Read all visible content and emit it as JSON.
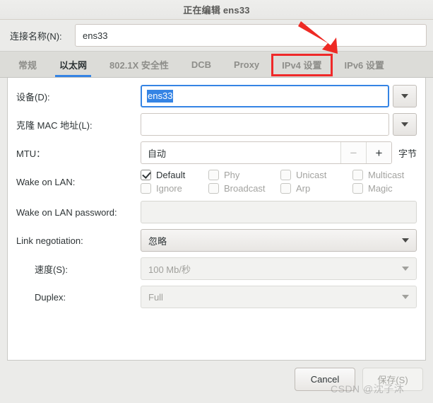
{
  "window": {
    "title": "正在编辑 ens33"
  },
  "connection": {
    "label": "连接名称(N):",
    "value": "ens33",
    "placeholder": ""
  },
  "tabs": [
    {
      "label": "常规",
      "active": false
    },
    {
      "label": "以太网",
      "active": true
    },
    {
      "label": "802.1X 安全性",
      "active": false
    },
    {
      "label": "DCB",
      "active": false
    },
    {
      "label": "Proxy",
      "active": false
    },
    {
      "label": "IPv4 设置",
      "active": false,
      "annotated": true
    },
    {
      "label": "IPv6 设置",
      "active": false
    }
  ],
  "form": {
    "device": {
      "label": "设备(D):",
      "value": "ens33",
      "selected": true
    },
    "cloned_mac": {
      "label": "克隆 MAC 地址(L):",
      "value": ""
    },
    "mtu": {
      "label": "MTU：",
      "value": "自动",
      "minus": "−",
      "plus": "+",
      "unit": "字节"
    },
    "wake_on_lan": {
      "label": "Wake on LAN:",
      "options": [
        {
          "label": "Default",
          "checked": true,
          "enabled": true
        },
        {
          "label": "Phy",
          "checked": false,
          "enabled": false
        },
        {
          "label": "Unicast",
          "checked": false,
          "enabled": false
        },
        {
          "label": "Multicast",
          "checked": false,
          "enabled": false
        },
        {
          "label": "Ignore",
          "checked": false,
          "enabled": false
        },
        {
          "label": "Broadcast",
          "checked": false,
          "enabled": false
        },
        {
          "label": "Arp",
          "checked": false,
          "enabled": false
        },
        {
          "label": "Magic",
          "checked": false,
          "enabled": false
        }
      ]
    },
    "wol_password": {
      "label": "Wake on LAN password:",
      "value": "",
      "enabled": false
    },
    "link_negotiation": {
      "label": "Link negotiation:",
      "value": "忽略",
      "enabled": true
    },
    "speed": {
      "label": "速度(S):",
      "value": "100 Mb/秒",
      "enabled": false
    },
    "duplex": {
      "label": "Duplex:",
      "value": "Full",
      "enabled": false
    }
  },
  "footer": {
    "cancel_label": "Cancel",
    "save_label": "保存(S)"
  },
  "annotation": {
    "highlight_color": "#ef2929",
    "accent_color": "#3584e4"
  },
  "watermark": {
    "text": "CSDN @沈子沐"
  }
}
